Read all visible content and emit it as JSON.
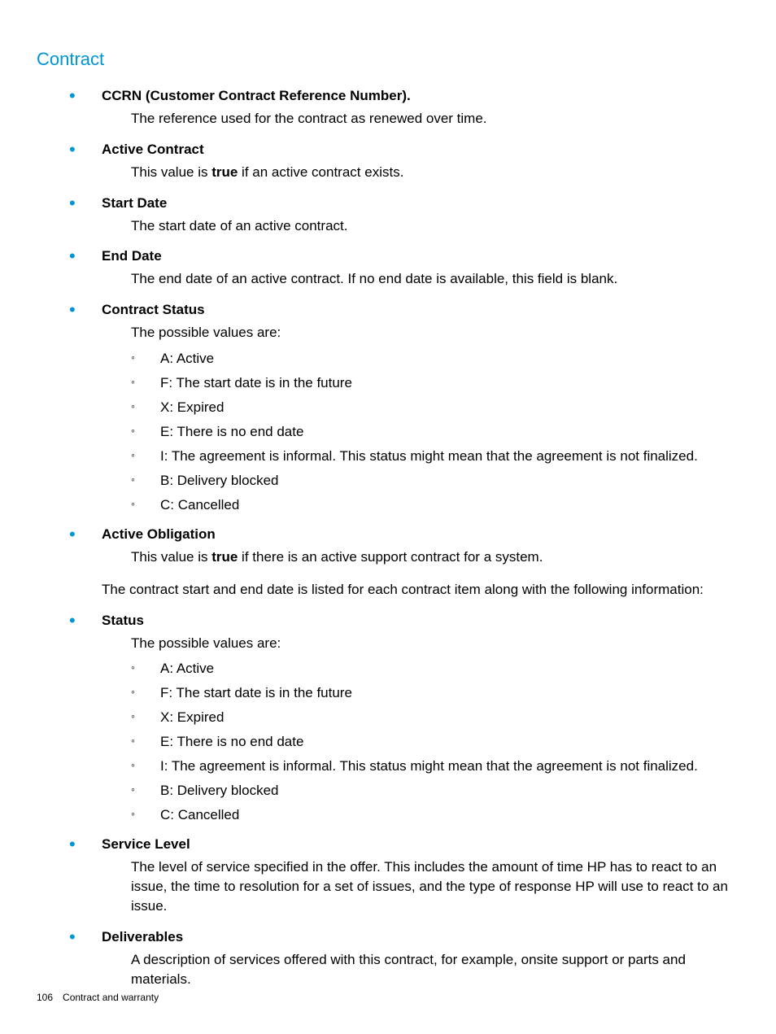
{
  "heading": "Contract",
  "items1": [
    {
      "term": "CCRN (Customer Contract Reference Number).",
      "desc_pre": "The reference used for the contract as renewed over time.",
      "desc_bold": "",
      "desc_post": ""
    },
    {
      "term": "Active Contract",
      "desc_pre": "This value is ",
      "desc_bold": "true",
      "desc_post": " if an active contract exists."
    },
    {
      "term": "Start Date",
      "desc_pre": "The start date of an active contract.",
      "desc_bold": "",
      "desc_post": ""
    },
    {
      "term": "End Date",
      "desc_pre": "The end date of an active contract. If no end date is available, this field is blank.",
      "desc_bold": "",
      "desc_post": ""
    }
  ],
  "contract_status": {
    "term": "Contract Status",
    "desc": "The possible values are:",
    "values": [
      "A: Active",
      "F: The start date is in the future",
      "X: Expired",
      "E: There is no end date",
      "I: The agreement is informal. This status might mean that the agreement is not finalized.",
      "B: Delivery blocked",
      "C: Cancelled"
    ]
  },
  "active_obligation": {
    "term": "Active Obligation",
    "desc_pre": "This value is ",
    "desc_bold": "true",
    "desc_post": " if there is an active support contract for a system."
  },
  "intermediate": "The contract start and end date is listed for each contract item along with the following information:",
  "status": {
    "term": "Status",
    "desc": "The possible values are:",
    "values": [
      "A: Active",
      "F: The start date is in the future",
      "X: Expired",
      "E: There is no end date",
      "I: The agreement is informal. This status might mean that the agreement is not finalized.",
      "B: Delivery blocked",
      "C: Cancelled"
    ]
  },
  "items2": [
    {
      "term": "Service Level",
      "desc": "The level of service specified in the offer. This includes the amount of time HP has to react to an issue, the time to resolution for a set of issues, and the type of response HP will use to react to an issue."
    },
    {
      "term": "Deliverables",
      "desc": "A description of services offered with this contract, for example, onsite support or parts and materials."
    }
  ],
  "footer": {
    "page": "106",
    "title": "Contract and warranty"
  }
}
